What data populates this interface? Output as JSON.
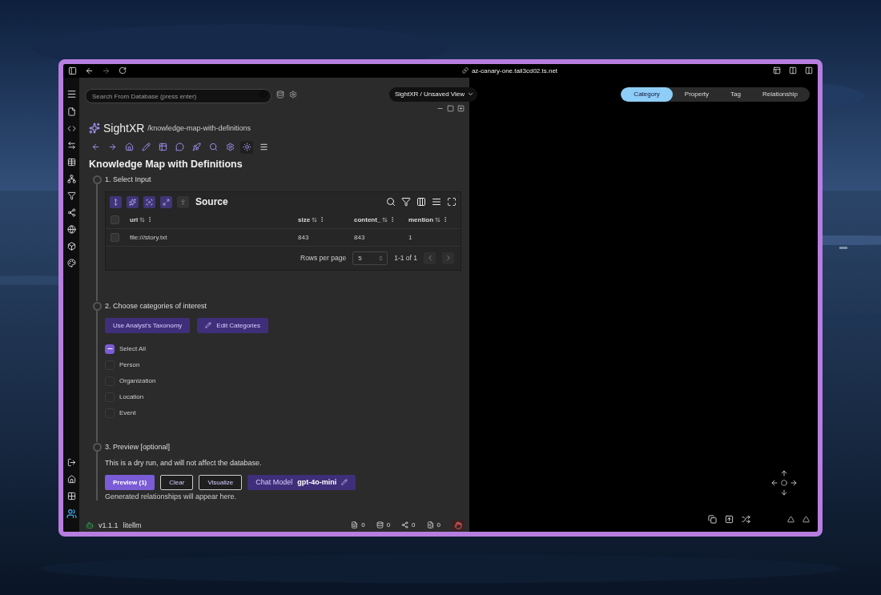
{
  "browser": {
    "url": "az-canary-one.tail3cd02.ts.net"
  },
  "header": {
    "search": {
      "placeholder": "Search From Database (press enter)"
    },
    "view_selector": "SightXR / Unsaved View"
  },
  "brand": {
    "name": "SightXR",
    "path": "/knowledge-map-with-definitions"
  },
  "title": "Knowledge Map with Definitions",
  "steps": [
    {
      "label": "1. Select Input"
    },
    {
      "label": "2. Choose categories of interest"
    },
    {
      "label": "3. Preview [optional]"
    }
  ],
  "table": {
    "title": "Source",
    "all_selected": false,
    "columns": [
      "uri",
      "size",
      "content_",
      "mention"
    ],
    "rows": [
      {
        "selected": false,
        "cells": [
          "file:///story.txt",
          "843",
          "843",
          "1"
        ]
      }
    ],
    "rows_per_page_label": "Rows per page",
    "rows_per_page": "5",
    "range": "1-1 of 1"
  },
  "categories": {
    "buttons": [
      {
        "label": "Use Analyst's Taxonomy",
        "kind": "plain"
      },
      {
        "label": "Edit Categories",
        "kind": "edit"
      }
    ],
    "options": [
      {
        "label": "Select All",
        "indeterminate": true
      },
      {
        "label": "Person",
        "checked": false
      },
      {
        "label": "Organization",
        "checked": false
      },
      {
        "label": "Location",
        "checked": false
      },
      {
        "label": "Event",
        "checked": false
      }
    ]
  },
  "preview": {
    "description": "This is a dry run, and will not affect the database.",
    "buttons": [
      {
        "label": "Preview (1)",
        "kind": "primary"
      },
      {
        "label": "Clear",
        "kind": "outline"
      },
      {
        "label": "Visualize",
        "kind": "outline"
      }
    ],
    "chat_model": {
      "label": "Chat Model",
      "value": "gpt-4o-mini"
    },
    "output": "Generated relationships will appear here."
  },
  "status_bar": {
    "version": "v1.1.1",
    "provider": "litellm",
    "counters": [
      "0",
      "0",
      "0",
      "0"
    ]
  },
  "view_tabs": [
    {
      "label": "Category",
      "selected": true
    },
    {
      "label": "Property",
      "selected": false
    },
    {
      "label": "Tag",
      "selected": false
    },
    {
      "label": "Relationship",
      "selected": false
    }
  ]
}
